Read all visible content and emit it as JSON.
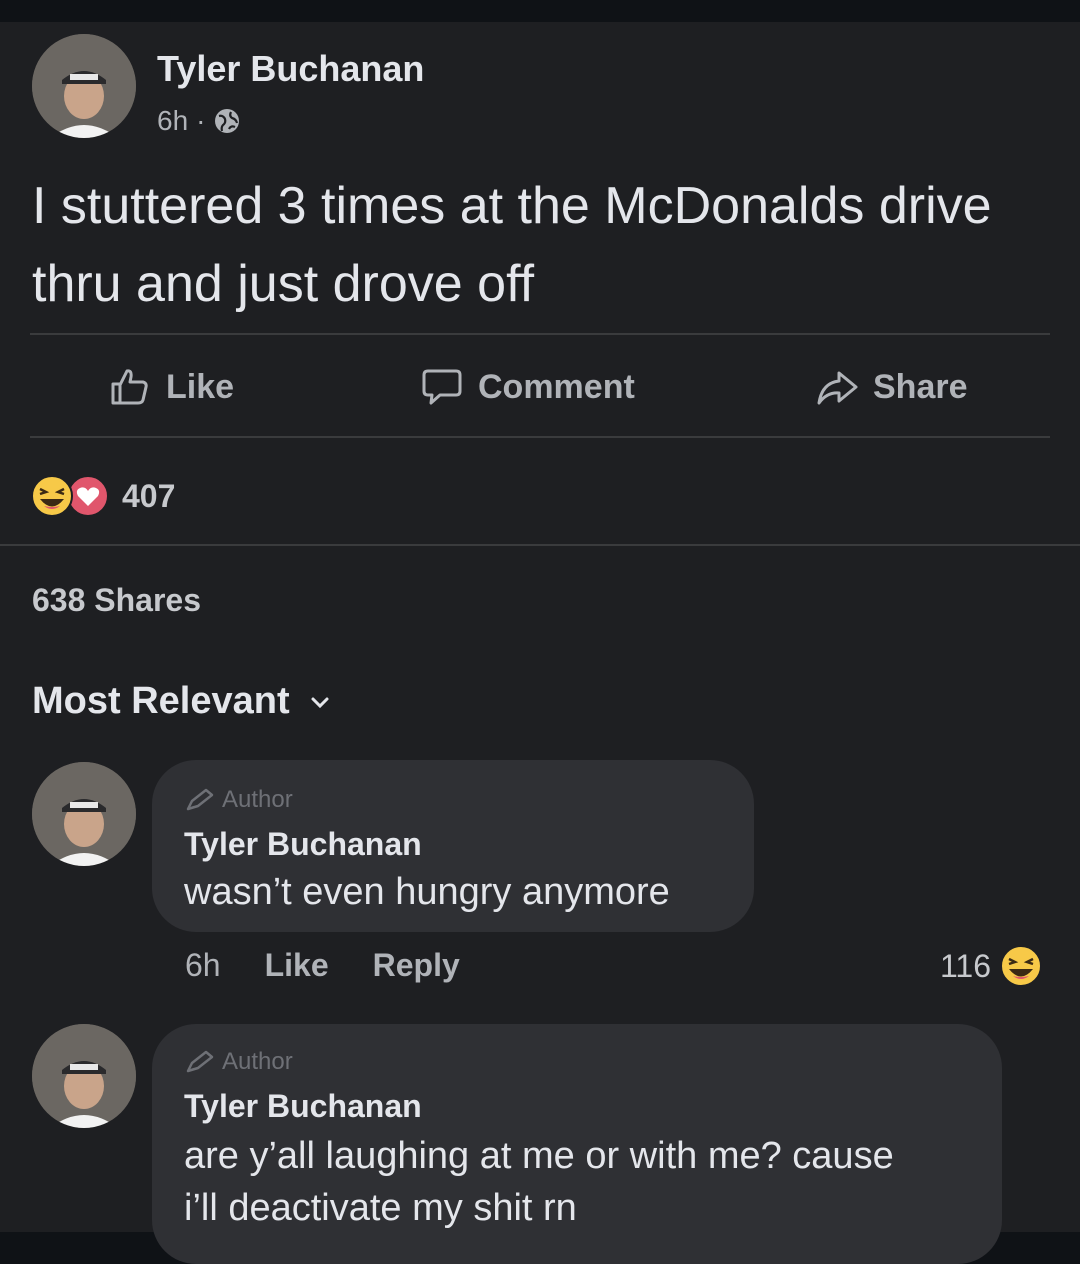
{
  "post": {
    "author": "Tyler Buchanan",
    "time": "6h",
    "separator": "·",
    "privacy_icon": "globe-icon",
    "text": "I stuttered 3 times at the McDonalds drive thru and just drove off"
  },
  "actions": {
    "like": "Like",
    "comment": "Comment",
    "share": "Share"
  },
  "reactions": {
    "icons": [
      "haha-icon",
      "love-icon"
    ],
    "count": "407"
  },
  "shares": "638 Shares",
  "sort": {
    "label": "Most Relevant"
  },
  "comments": [
    {
      "badge": "Author",
      "name": "Tyler Buchanan",
      "text": "wasn’t even hungry anymore",
      "time": "6h",
      "like": "Like",
      "reply": "Reply",
      "reaction_count": "116",
      "reaction_icon": "haha-icon"
    },
    {
      "badge": "Author",
      "name": "Tyler Buchanan",
      "text_line1": "are y’all laughing at me or with me? cause",
      "text_line2": "i’ll deactivate my shit rn"
    }
  ],
  "colors": {
    "background": "#1e1f22",
    "bubble": "#2f3034",
    "text": "#e4e6eb",
    "secondary": "#b0b3b8",
    "haha": "#f7c948",
    "love": "#e0566c"
  }
}
